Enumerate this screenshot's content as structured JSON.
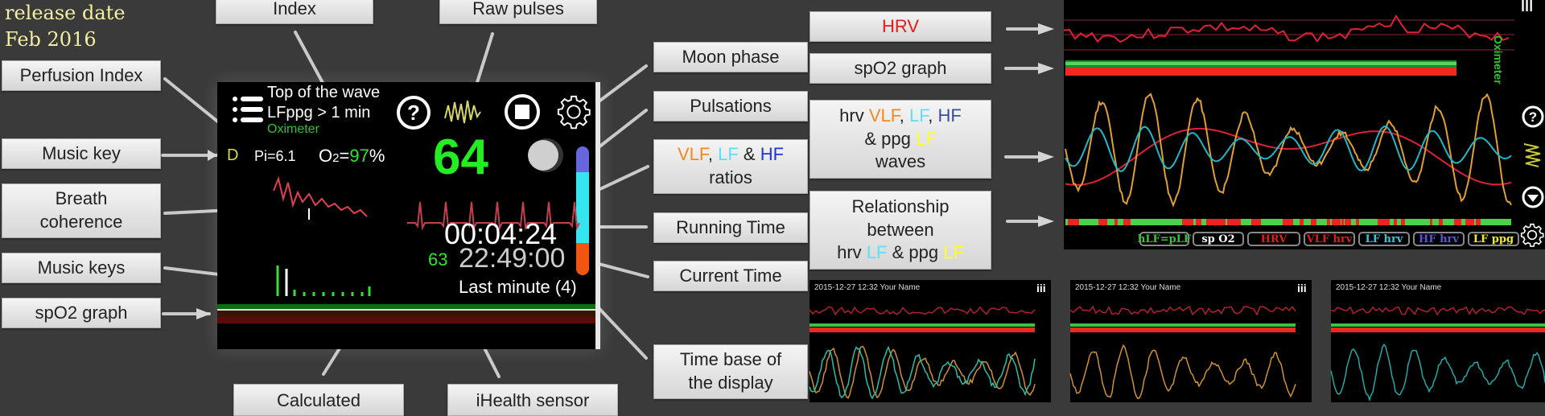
{
  "release": {
    "line1": "release date",
    "line2": "Feb 2016"
  },
  "callouts": {
    "perfusion_index": "Perfusion Index",
    "index": "Index",
    "raw_pulses": "Raw pulses",
    "music_key": "Music key",
    "breath_coherence_1": "Breath",
    "breath_coherence_2": "coherence",
    "music_keys": "Music keys",
    "spo2_graph_left": "spO2 graph",
    "calculated": "Calculated",
    "ihealth_sensor": "iHealth sensor",
    "moon_phase": "Moon phase",
    "pulsations": "Pulsations",
    "ratios": {
      "vlf": "VLF",
      "comma": ", ",
      "lf": "LF",
      "amp": " & ",
      "hf": "HF",
      "line2": "ratios"
    },
    "running_time": "Running Time",
    "current_time": "Current Time",
    "time_base_1": "Time base of",
    "time_base_2": "the display",
    "hrv": "HRV",
    "spo2_graph_right": "spO2 graph",
    "waves": {
      "hrv": "hrv ",
      "vlf": "VLF",
      "c1": ", ",
      "lf": "LF",
      "c2": ", ",
      "hf": "HF",
      "ppg": "& ppg ",
      "ppg_lf": "LF",
      "line3": "waves"
    },
    "relationship": {
      "line1": "Relationship",
      "line2": "between",
      "hrv": "hrv ",
      "lf": "LF",
      "ppg": " & ppg ",
      "ppg_lf": "LF"
    }
  },
  "phone": {
    "top_text_1": "Top of the wave",
    "top_text_2": "LFppg > 1 min",
    "source": "Oximeter",
    "music_key": "D",
    "pi": "Pi=6.1",
    "o2_prefix": "O",
    "o2_sub": "2",
    "o2_eq": "=",
    "o2_value": "97",
    "o2_unit": "%",
    "heart_rate": "64",
    "running_time": "00:04:24",
    "current_time": "22:49:00",
    "sensor_value": "63",
    "time_base": "Last minute (4)",
    "ratio_bar": {
      "vlf_pct": 20,
      "lf_pct": 55,
      "hf_pct": 25
    },
    "colors": {
      "green": "#2ee62e",
      "hr": "#22ee22",
      "ecg": "#c04050",
      "breath": "#e04050"
    }
  },
  "right_screen": {
    "side_label": "Oximeter",
    "tabs": [
      {
        "label": "hLF=pLF",
        "color": "#39c439"
      },
      {
        "label": "sp O2",
        "color": "#ffffff"
      },
      {
        "label": "HRV",
        "color": "#e21b1b"
      },
      {
        "label": "VLF hrv",
        "color": "#e21b1b"
      },
      {
        "label": "LF hrv",
        "color": "#34c7d8"
      },
      {
        "label": "HF hrv",
        "color": "#5555dd"
      },
      {
        "label": "LF ppg",
        "color": "#eeee22"
      }
    ]
  },
  "thumbnails": [
    {
      "header": "2015-12-27 12:32   Your Name",
      "menu": "iii"
    },
    {
      "header": "2015-12-27 12:32   Your Name",
      "menu": "iii"
    },
    {
      "header": "2015-12-27 12:32   Your Name",
      "menu": ""
    }
  ]
}
